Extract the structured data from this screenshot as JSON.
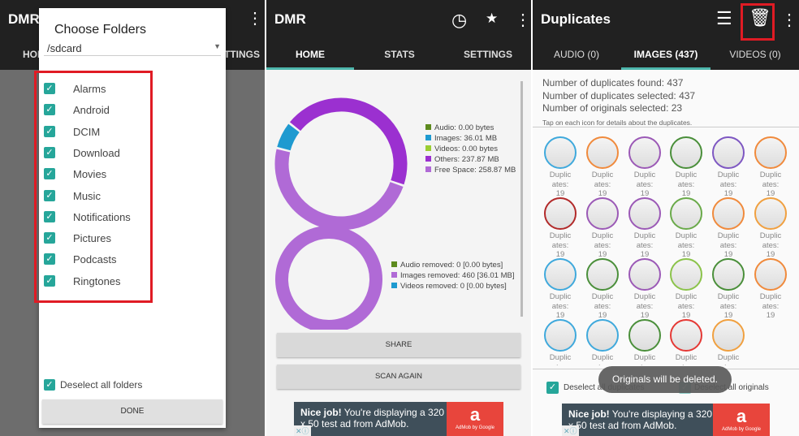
{
  "folders_screen": {
    "app_title": "DMR",
    "bg_tabs": [
      "HOME",
      "SETTINGS"
    ],
    "dialog_title": "Choose Folders",
    "path": "/sdcard",
    "folders": [
      "Alarms",
      "Android",
      "DCIM",
      "Download",
      "Movies",
      "Music",
      "Notifications",
      "Pictures",
      "Podcasts",
      "Ringtones"
    ],
    "deselect_label": "Deselect all folders",
    "done_label": "DONE"
  },
  "home_screen": {
    "app_title": "DMR",
    "icons": [
      "clock-icon",
      "star-icon",
      "more-vert-icon"
    ],
    "tabs": [
      "HOME",
      "STATS",
      "SETTINGS"
    ],
    "active_tab": "HOME",
    "share_label": "SHARE",
    "scan_label": "SCAN AGAIN"
  },
  "chart_data": [
    {
      "type": "pie",
      "style": "donut",
      "legend": [
        "Audio: 0.00 bytes",
        "Images: 36.01 MB",
        "Videos: 0.00 bytes",
        "Others: 237.87 MB",
        "Free Space: 258.87 MB"
      ],
      "labels": [
        "Audio",
        "Images",
        "Videos",
        "Others",
        "Free Space"
      ],
      "values": [
        0,
        36.01,
        0,
        237.87,
        258.87
      ],
      "unit": "MB",
      "colors": [
        "#5d8a1e",
        "#1e9ad0",
        "#9acd32",
        "#9b30d0",
        "#b06ad6"
      ]
    },
    {
      "type": "pie",
      "style": "donut",
      "legend": [
        "Audio removed: 0 [0.00 bytes]",
        "Images removed: 460 [36.01 MB]",
        "Videos removed: 0 [0.00 bytes]"
      ],
      "labels": [
        "Audio removed",
        "Images removed",
        "Videos removed"
      ],
      "values": [
        0,
        460,
        0
      ],
      "colors": [
        "#5d8a1e",
        "#b06ad6",
        "#1e9ad0"
      ]
    }
  ],
  "dup_screen": {
    "title": "Duplicates",
    "icons": [
      "list-icon",
      "trash-icon",
      "more-vert-icon"
    ],
    "tabs": [
      "AUDIO (0)",
      "IMAGES (437)",
      "VIDEOS (0)"
    ],
    "active_tab": "IMAGES (437)",
    "stats": [
      "Number of duplicates found: 437",
      "Number of duplicates selected: 437",
      "Number of originals selected: 23"
    ],
    "tip": "Tap on each icon for details about the duplicates.",
    "thumb_label_1": "Duplic",
    "thumb_label_2": "ates:",
    "thumb_count": "19",
    "thumb_colors": [
      "#3fa9dc",
      "#f08a3c",
      "#9b59b6",
      "#4a8f3a",
      "#7e57c2",
      "#f08a3c",
      "#b22a2a",
      "#9b59b6",
      "#9b59b6",
      "#6aaa4a",
      "#f08a3c",
      "#f0a040",
      "#3fa9dc",
      "#4a8f3a",
      "#9b59b6",
      "#8bc34a",
      "#4a8f3a",
      "#f08a3c",
      "#3fa9dc",
      "#3fa9dc",
      "#4a8f3a",
      "#e53935",
      "#f0a040"
    ],
    "deselect_dups": "Deselect all duplicates",
    "deselect_orig": "Deselect all originals",
    "toast": "Originals will be deleted."
  },
  "ad": {
    "bold": "Nice job!",
    "text": " You're displaying a 320 x 50 test ad from AdMob.",
    "logo": "AdMob by Google"
  },
  "accent": "#26a69a",
  "highlight": "#e01b24"
}
